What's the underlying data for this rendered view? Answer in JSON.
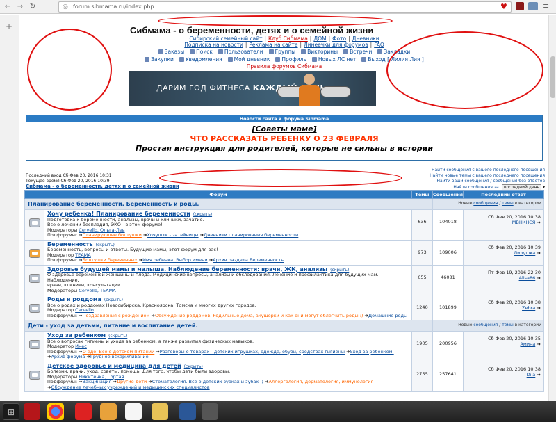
{
  "browser": {
    "url": "forum.sibmama.ru/index.php",
    "back": "←",
    "forward": "→",
    "reload": "↻"
  },
  "header": {
    "title": "Сибмама - о беременности, детях и о семейной жизни",
    "nav1": [
      "Сибирский семейный сайт",
      "Клуб Сибмама",
      "ДОМ",
      "Фото",
      "Дневники"
    ],
    "nav2": [
      "Подписка на новости",
      "Реклама на сайте",
      "Линеечки для форумов",
      "FAQ"
    ],
    "icons1": [
      "Заказы",
      "Поиск",
      "Пользователи",
      "Группы",
      "Викторины",
      "Встречи",
      "Закладки"
    ],
    "icons2": [
      "Закупки",
      "Уведомления",
      "Мой дневник",
      "Профиль",
      "Новых ЛС нет",
      "Выход [ Лилия Лия ]"
    ],
    "rules": "Правила форумов Сибмама",
    "banner_text_1": "ДАРИМ ГОД ФИТНЕСА ",
    "banner_text_2": "КАЖДЫЙ ДЕНЬ"
  },
  "news": {
    "header": "Новости сайта и форума Sibmama",
    "line1": "[Советы маме]",
    "line2": "ЧТО РАССКАЗАТЬ РЕБЕНКУ О 23 ФЕВРАЛЯ",
    "line3": "Простая инструкция для родителей, которые не сильны в истории"
  },
  "session": {
    "last_visit": "Последний вход Сб Фев 20, 2016 10:31",
    "current_time": "Текущее время Сб Фев 20, 2016 10:39",
    "site_name": "Сибмама - о беременности, детях и о семейной жизни",
    "links": [
      "Найти сообщения с вашего последнего посещения",
      "Найти новые темы с вашего последнего посещения",
      "Найти ваши сообщения / сообщения без ответов"
    ],
    "find_label": "Найти сообщения за",
    "find_select": "последний день"
  },
  "table": {
    "headers": [
      "Форум",
      "Темы",
      "Сообщения",
      "Последний ответ"
    ],
    "cat_right_prefix": "Новые ",
    "cat_right_link1": "сообщения",
    "cat_right_mid": " / ",
    "cat_right_link2": "темы",
    "cat_right_suffix": " в категории",
    "hide_label": "(скрыть)",
    "moderators_label": "Модераторы",
    "moderator_label": "Модератор",
    "subforums_label": "Подфорумы:",
    "categories": [
      {
        "name": "Планирование беременности. Беременность и роды.",
        "forums": [
          {
            "name": "Хочу ребенка! Планирование беременности",
            "desc1": "Подготовка к беременности, анализы, врачи и клиники, зачатие.",
            "desc2": "Все о лечении бесплодия, ЭКО - в этом форуме!",
            "mods": "Cervello, Ольга-Лев",
            "subs": [
              "Планирующие болтушки",
              "Хочушки - затейницы",
              "Дневники планирования беременности"
            ],
            "topics": "636",
            "posts": "104018",
            "last_date": "Сб Фев 20, 2016 10:38",
            "last_user": "МВНКНСЯ",
            "icon_orange": false
          },
          {
            "name": "Беременность",
            "desc1": "Беременность, вопросы и ответы. Будущие мамы, этот форум для вас!",
            "desc2": "",
            "mods": "TEAMA",
            "subs": [
              "Болтушки беременных",
              "Имя ребенка. Выбор имени",
              "Архив раздела Беременность"
            ],
            "topics": "973",
            "posts": "109006",
            "last_date": "Сб Фев 20, 2016 10:39",
            "last_user": "Лилушка",
            "icon_orange": true
          },
          {
            "name": "Здоровье будущей мамы и малыша. Наблюдение беременности: врачи, ЖК, анализы",
            "desc1": "О здоровье беременной женщины и плода. Медицинские вопросы, анализы и обследования. Лечение и профилактика для будущих мам. Наблюдение,",
            "desc2": "врачи, клиники, консультации.",
            "mods": "Cervello, TEAMA",
            "subs": [],
            "topics": "655",
            "posts": "46081",
            "last_date": "Пт Фев 19, 2016 22:30",
            "last_user": "Alisa86",
            "icon_orange": false
          },
          {
            "name": "Роды и роддома",
            "desc1": "Все о родах и роддомах Новосибирска, Красноярска, Томска и многих других городов.",
            "desc2": "",
            "mods": "Cervello",
            "subs": [
              "Поздравления с рождением",
              "Обсуждение роддомов. Родильные дома, акушерки и как они могут облегчить роды :)",
              "Домашние роды"
            ],
            "topics": "1240",
            "posts": "101899",
            "last_date": "Сб Фев 20, 2016 10:38",
            "last_user": "Zebra",
            "icon_orange": false
          }
        ]
      },
      {
        "name": "Дети - уход за детьми, питание и воспитание детей.",
        "forums": [
          {
            "name": "Уход за ребенком",
            "desc1": "Все о вопросах гигиены и ухода за ребенком, а также развития физических навыков.",
            "desc2": "",
            "mods": "Инес",
            "subs": [
              "О еде. Все о детском питании",
              "Разговоры о товарах - детских игрушках, одежде, обуви, средствах гигиены",
              "Уход за ребенком.",
              "Архив форума",
              "Грудное вскармливание"
            ],
            "topics": "1905",
            "posts": "200956",
            "last_date": "Сб Фев 20, 2016 10:35",
            "last_user": "Амина",
            "icon_orange": false
          },
          {
            "name": "Детское здоровье и медицина для детей",
            "desc1": "Болезни, врачи, уход, советы, помощь. Для того, чтобы дети были здоровы.",
            "desc2": "",
            "mods": "Никитенка, Гортая",
            "subs": [
              "Вакцинация",
              "Другие дети",
              "Стоматология. Все о детских зубках и зубах :)",
              "Аллергология, дерматология, иммунология",
              "Обсуждение лечебных учреждений и медицинских специалистов"
            ],
            "topics": "2755",
            "posts": "257641",
            "last_date": "Сб Фев 20, 2016 10:38",
            "last_user": "Dila",
            "icon_orange": false
          }
        ]
      }
    ]
  },
  "colors": {
    "accent": "#2f7bc2",
    "link": "#0a4d9c",
    "alert": "#ff3300",
    "annotation": "#e01010"
  }
}
